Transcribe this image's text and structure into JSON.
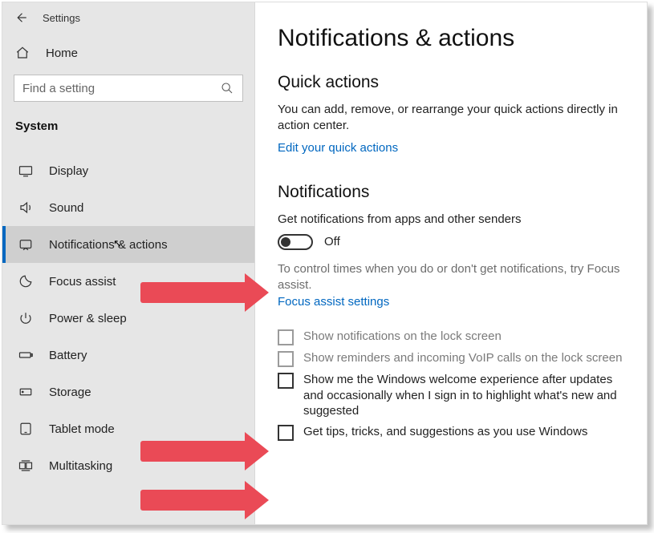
{
  "titlebar": {
    "title": "Settings"
  },
  "home": {
    "label": "Home"
  },
  "search": {
    "placeholder": "Find a setting"
  },
  "section_label": "System",
  "nav": [
    {
      "label": "Display"
    },
    {
      "label": "Sound"
    },
    {
      "label": "Notifications & actions"
    },
    {
      "label": "Focus assist"
    },
    {
      "label": "Power & sleep"
    },
    {
      "label": "Battery"
    },
    {
      "label": "Storage"
    },
    {
      "label": "Tablet mode"
    },
    {
      "label": "Multitasking"
    }
  ],
  "content": {
    "heading": "Notifications & actions",
    "quick_actions": {
      "title": "Quick actions",
      "body": "You can add, remove, or rearrange your quick actions directly in action center.",
      "link": "Edit your quick actions"
    },
    "notifications": {
      "title": "Notifications",
      "toggle_desc": "Get notifications from apps and other senders",
      "toggle_state": "Off",
      "focus_body": "To control times when you do or don't get notifications, try Focus assist.",
      "focus_link": "Focus assist settings",
      "checks": [
        {
          "label": "Show notifications on the lock screen",
          "disabled": true
        },
        {
          "label": "Show reminders and incoming VoIP calls on the lock screen",
          "disabled": true
        },
        {
          "label": "Show me the Windows welcome experience after updates and occasionally when I sign in to highlight what's new and suggested",
          "disabled": false
        },
        {
          "label": "Get tips, tricks, and suggestions as you use Windows",
          "disabled": false
        }
      ]
    }
  },
  "colors": {
    "accent": "#0067c0",
    "arrow": "#ea4a56"
  }
}
